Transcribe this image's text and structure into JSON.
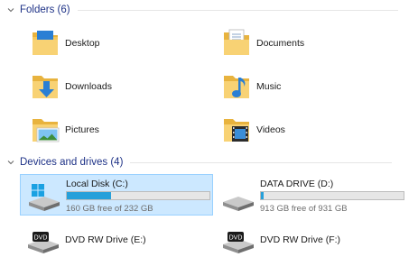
{
  "folders_section": {
    "title": "Folders (6)"
  },
  "folders": [
    {
      "name": "Desktop",
      "icon": "desktop-folder-icon"
    },
    {
      "name": "Documents",
      "icon": "documents-folder-icon"
    },
    {
      "name": "Downloads",
      "icon": "downloads-folder-icon"
    },
    {
      "name": "Music",
      "icon": "music-folder-icon"
    },
    {
      "name": "Pictures",
      "icon": "pictures-folder-icon"
    },
    {
      "name": "Videos",
      "icon": "videos-folder-icon"
    }
  ],
  "devices_section": {
    "title": "Devices and drives (4)"
  },
  "drives": [
    {
      "name": "Local Disk (C:)",
      "free_text": "160 GB free of 232 GB",
      "used_fraction": 0.31,
      "icon": "windows-drive-icon",
      "selected": true
    },
    {
      "name": "DATA DRIVE (D:)",
      "free_text": "913 GB free of 931 GB",
      "used_fraction": 0.02,
      "icon": "hard-drive-icon",
      "selected": false
    }
  ],
  "optical_drives": [
    {
      "name": "DVD RW Drive (E:)",
      "icon": "dvd-drive-icon",
      "icon_label": "DVD"
    },
    {
      "name": "DVD RW Drive (F:)",
      "icon": "dvd-drive-icon",
      "icon_label": "DVD"
    }
  ],
  "colors": {
    "section_title": "#1e3287",
    "selection": "#cce8ff",
    "bar_fill": "#26a0da",
    "folder": "#f5c75a"
  }
}
